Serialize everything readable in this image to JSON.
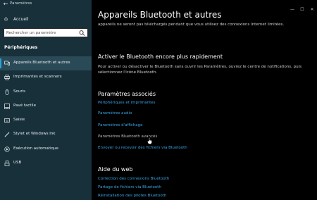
{
  "window": {
    "title": "Paramètres",
    "controls": [
      "—",
      "☐",
      "✕"
    ]
  },
  "sidebar": {
    "home_label": "Accueil",
    "search_placeholder": "Rechercher un paramètre",
    "section": "Périphériques",
    "items": [
      {
        "label": "Appareils Bluetooth et autres",
        "icon": "bluetooth-devices-icon",
        "active": true
      },
      {
        "label": "Imprimantes et scanners",
        "icon": "printer-icon"
      },
      {
        "label": "Souris",
        "icon": "mouse-icon"
      },
      {
        "label": "Pavé tactile",
        "icon": "touchpad-icon"
      },
      {
        "label": "Saisie",
        "icon": "keyboard-icon"
      },
      {
        "label": "Stylet et Windows Ink",
        "icon": "pen-icon"
      },
      {
        "label": "Exécution automatique",
        "icon": "autoplay-icon"
      },
      {
        "label": "USB",
        "icon": "usb-icon"
      }
    ]
  },
  "main": {
    "title": "Appareils Bluetooth et autres",
    "intro": "appareils ne seront pas téléchargés pendant que vous utilisez des connexions Internet limitées.",
    "quick": {
      "heading": "Activer le Bluetooth encore plus rapidement",
      "text": "Pour activer ou désactiver le Bluetooth sans ouvrir les Paramètres, ouvrez le centre de notifications, puis sélectionnez l'icône Bluetooth."
    },
    "related": {
      "heading": "Paramètres associés",
      "links": [
        "Périphériques et imprimantes",
        "Paramètres audio",
        "Paramètres d'affichage",
        "Paramètres Bluetooth avancés",
        "Envoyer ou recevoir des fichiers via Bluetooth"
      ]
    },
    "web_help": {
      "heading": "Aide du web",
      "links": [
        "Correction des connexions Bluetooth",
        "Partage de fichiers via Bluetooth",
        "Réinstallation des pilotes Bluetooth"
      ]
    }
  },
  "colors": {
    "sidebar_bg": "#17303a",
    "active_item_bg": "#2b4a57",
    "accent": "#27a4e0",
    "link": "#36a6e8",
    "main_bg": "#000000"
  }
}
